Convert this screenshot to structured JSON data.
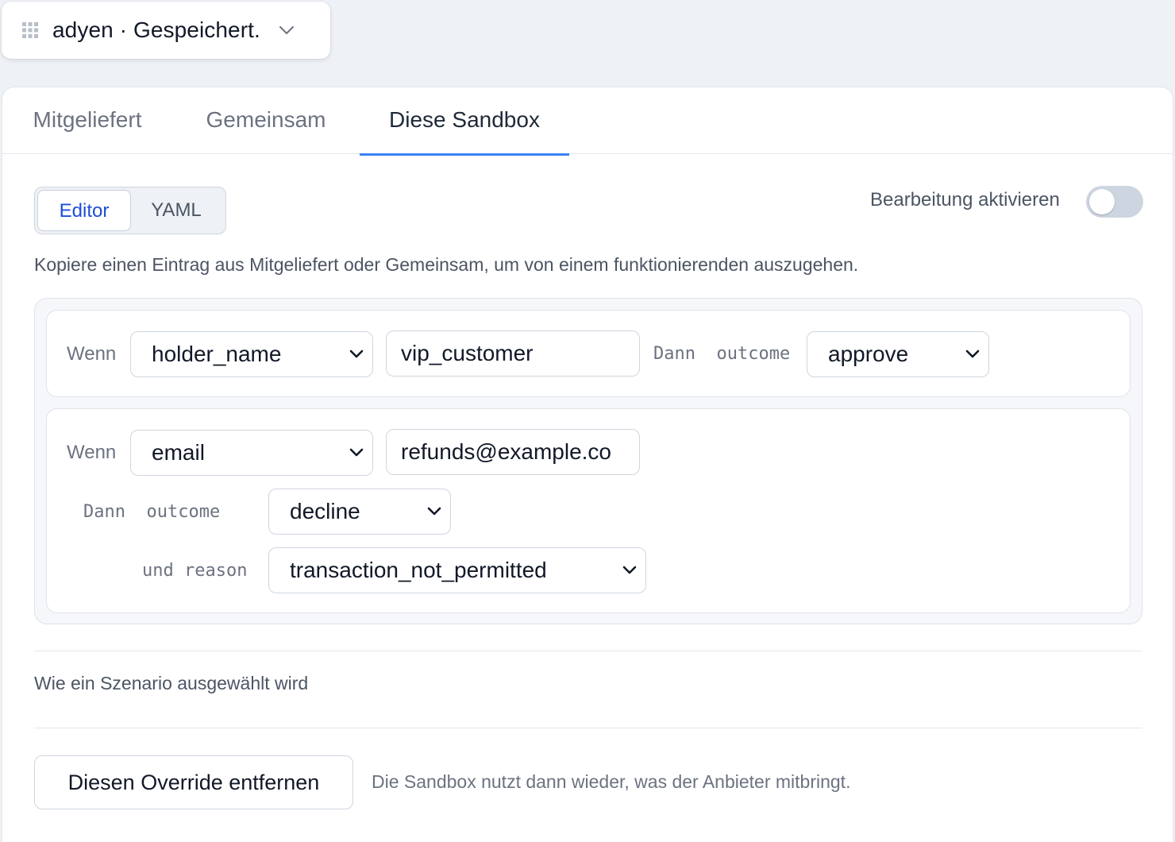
{
  "header": {
    "grid_icon": "grid-icon",
    "title": "adyen · Gespeichert.",
    "chevron_icon": "chevron-down-icon"
  },
  "tabs": [
    {
      "label": "Mitgeliefert",
      "active": false
    },
    {
      "label": "Gemeinsam",
      "active": false
    },
    {
      "label": "Diese Sandbox",
      "active": true
    }
  ],
  "mode_switch": {
    "editor_label": "Editor",
    "yaml_label": "YAML",
    "selected": "Editor"
  },
  "edit_toggle": {
    "label": "Bearbeitung aktivieren",
    "enabled": false
  },
  "hint": "Kopiere einen Eintrag aus Mitgeliefert oder Gemeinsam, um von einem funktionierenden auszugehen.",
  "rules": [
    {
      "when_label": "Wenn",
      "field": "holder_name",
      "value": "vip_customer",
      "then_label": "Dann",
      "outcome_key": "outcome",
      "outcome": "approve"
    },
    {
      "when_label": "Wenn",
      "field": "email",
      "value": "refunds@example.co",
      "then_label": "Dann",
      "outcome_key": "outcome",
      "outcome": "decline",
      "and_label": "und",
      "reason_key": "reason",
      "reason": "transaction_not_permitted"
    }
  ],
  "scenario_section": "Wie ein Szenario ausgewählt wird",
  "remove_override": {
    "button_label": "Diesen Override entfernen",
    "note": "Die Sandbox nutzt dann wieder, was der Anbieter mitbringt."
  },
  "colors": {
    "accent": "#3b82f6",
    "segment_active_text": "#1d4ed8",
    "toggle_off": "#cdd5e0"
  }
}
